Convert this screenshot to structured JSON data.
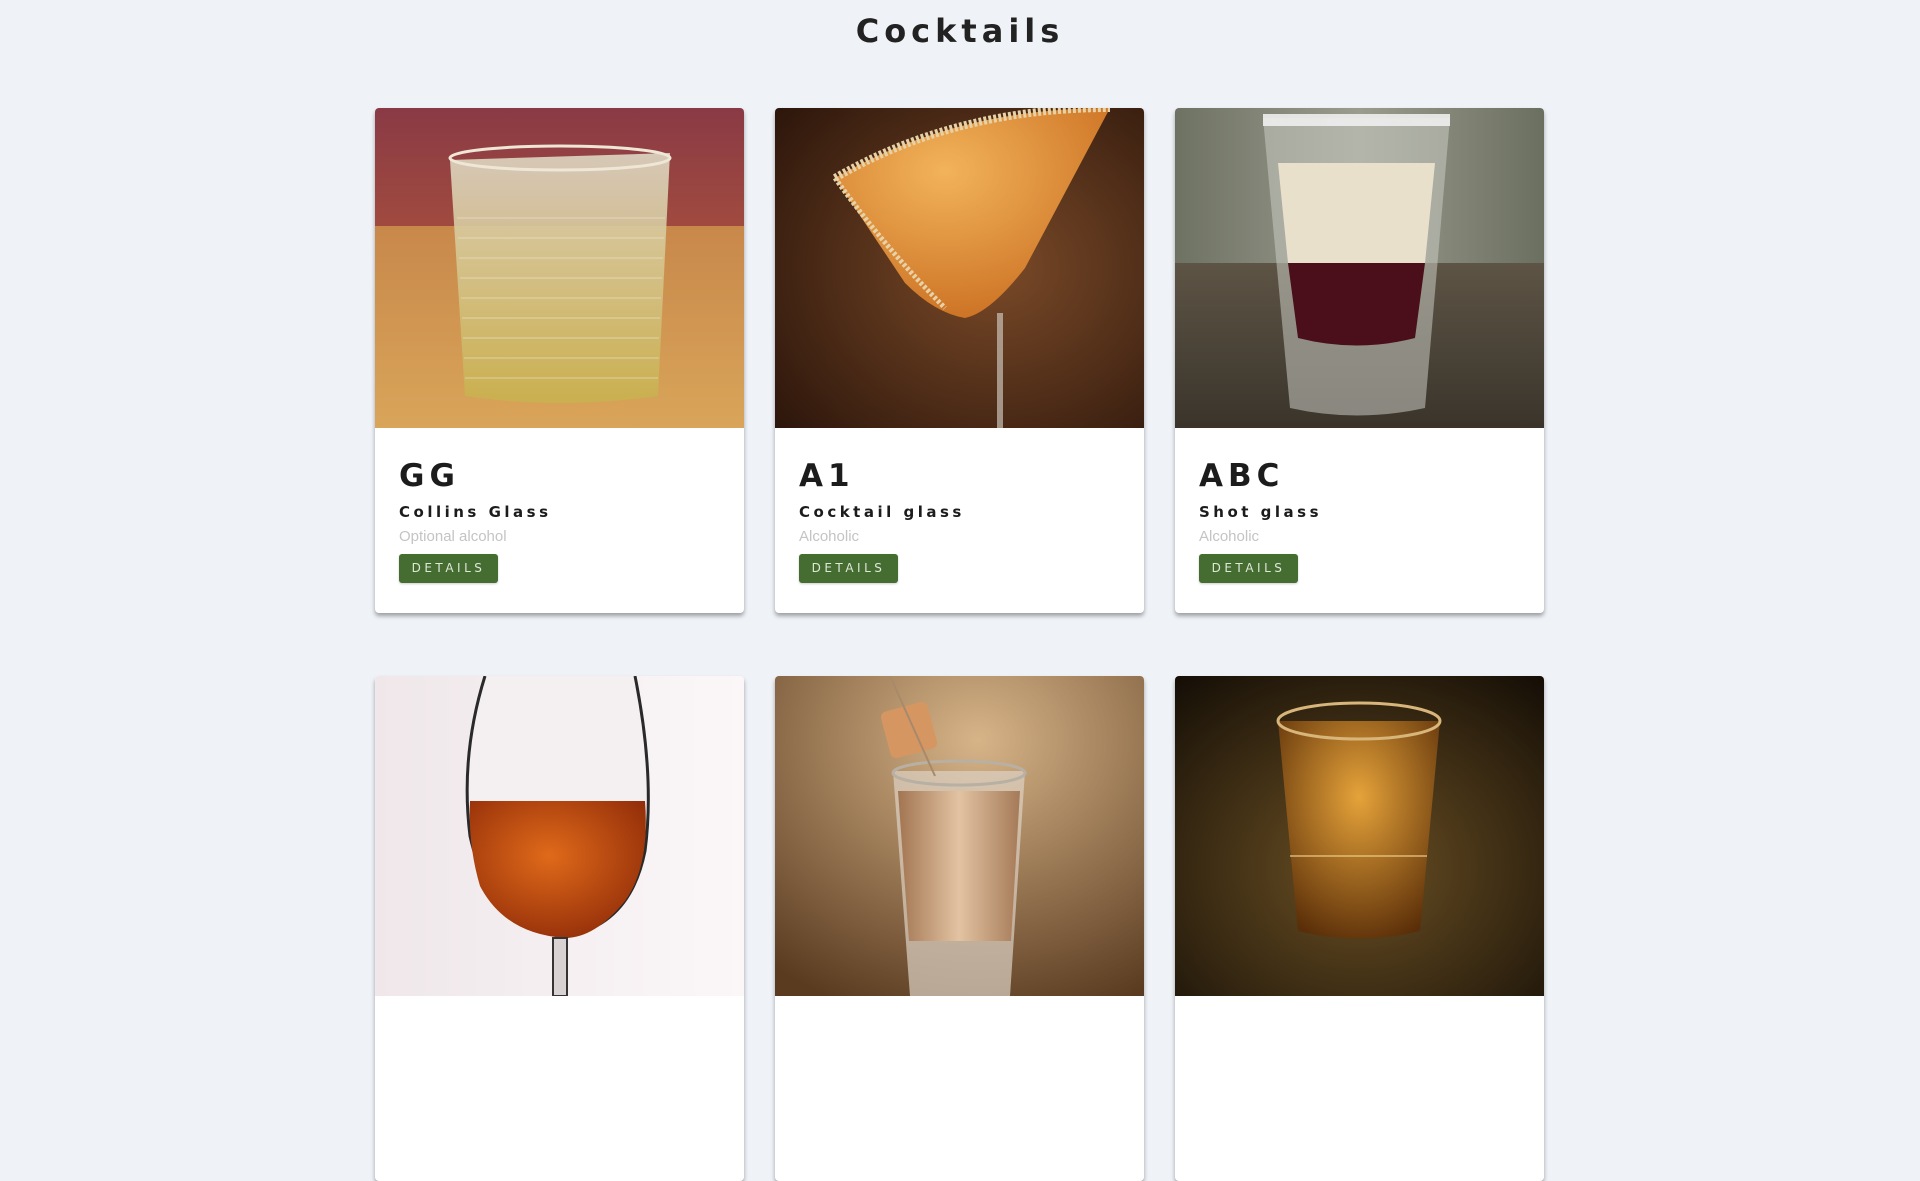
{
  "page": {
    "title": "Cocktails"
  },
  "cards": [
    {
      "name": "GG",
      "glass": "Collins Glass",
      "alcohol": "Optional alcohol",
      "button": "DETAILS"
    },
    {
      "name": "A1",
      "glass": "Cocktail glass",
      "alcohol": "Alcoholic",
      "button": "DETAILS"
    },
    {
      "name": "ABC",
      "glass": "Shot glass",
      "alcohol": "Alcoholic",
      "button": "DETAILS"
    },
    {
      "name": "",
      "glass": "",
      "alcohol": "",
      "button": ""
    },
    {
      "name": "",
      "glass": "",
      "alcohol": "",
      "button": ""
    },
    {
      "name": "",
      "glass": "",
      "alcohol": "",
      "button": ""
    }
  ],
  "colors": {
    "background": "#eff3f7",
    "button": "#456d31",
    "button_text": "#dfe8d8",
    "muted_text": "#c4c4c4"
  }
}
